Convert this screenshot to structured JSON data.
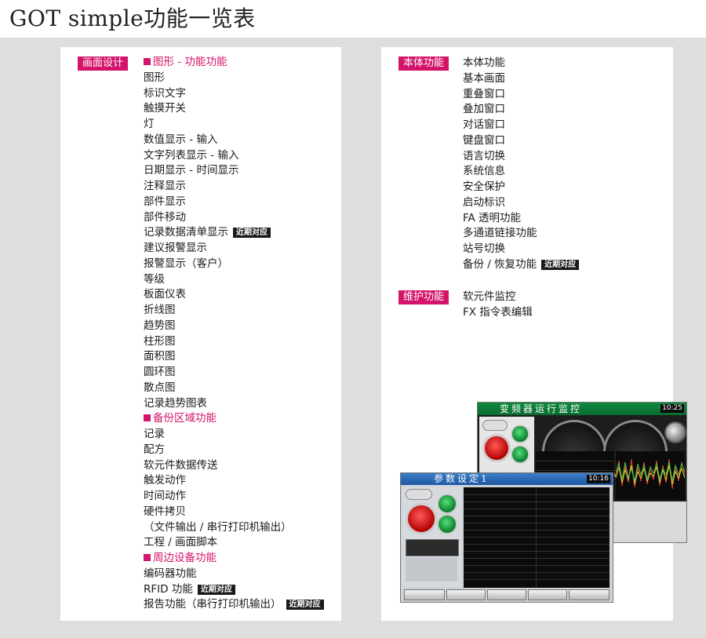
{
  "page": {
    "title": "GOT simple功能一览表"
  },
  "badge_label": "近期对应",
  "left": {
    "tag": "画面设计",
    "items": [
      {
        "text": "图形 - 功能功能",
        "section": true,
        "badge": false
      },
      {
        "text": "图形",
        "section": false,
        "badge": false
      },
      {
        "text": "标识文字",
        "section": false,
        "badge": false
      },
      {
        "text": "触摸开关",
        "section": false,
        "badge": false
      },
      {
        "text": "灯",
        "section": false,
        "badge": false
      },
      {
        "text": "数值显示 - 输入",
        "section": false,
        "badge": false
      },
      {
        "text": "文字列表显示 - 输入",
        "section": false,
        "badge": false
      },
      {
        "text": "日期显示 - 时间显示",
        "section": false,
        "badge": false
      },
      {
        "text": "注释显示",
        "section": false,
        "badge": false
      },
      {
        "text": "部件显示",
        "section": false,
        "badge": false
      },
      {
        "text": "部件移动",
        "section": false,
        "badge": false
      },
      {
        "text": "记录数据清单显示",
        "section": false,
        "badge": true
      },
      {
        "text": "建议报警显示",
        "section": false,
        "badge": false
      },
      {
        "text": "报警显示（客户）",
        "section": false,
        "badge": false
      },
      {
        "text": "等级",
        "section": false,
        "badge": false
      },
      {
        "text": "板面仪表",
        "section": false,
        "badge": false
      },
      {
        "text": "折线图",
        "section": false,
        "badge": false
      },
      {
        "text": "趋势图",
        "section": false,
        "badge": false
      },
      {
        "text": "柱形图",
        "section": false,
        "badge": false
      },
      {
        "text": "面积图",
        "section": false,
        "badge": false
      },
      {
        "text": "圆环图",
        "section": false,
        "badge": false
      },
      {
        "text": "散点图",
        "section": false,
        "badge": false
      },
      {
        "text": "记录趋势图表",
        "section": false,
        "badge": false
      },
      {
        "text": "备份区域功能",
        "section": true,
        "badge": false
      },
      {
        "text": "记录",
        "section": false,
        "badge": false
      },
      {
        "text": "配方",
        "section": false,
        "badge": false
      },
      {
        "text": "软元件数据传送",
        "section": false,
        "badge": false
      },
      {
        "text": "触发动作",
        "section": false,
        "badge": false
      },
      {
        "text": "时间动作",
        "section": false,
        "badge": false
      },
      {
        "text": "硬件拷贝",
        "section": false,
        "badge": false
      },
      {
        "text": "（文件输出 / 串行打印机输出）",
        "section": false,
        "badge": false
      },
      {
        "text": "工程 / 画面脚本",
        "section": false,
        "badge": false
      },
      {
        "text": "周边设备功能",
        "section": true,
        "badge": false
      },
      {
        "text": "编码器功能",
        "section": false,
        "badge": false
      },
      {
        "text": "RFID 功能",
        "section": false,
        "badge": true
      },
      {
        "text": "报告功能（串行打印机输出）",
        "section": false,
        "badge": true
      }
    ]
  },
  "right": {
    "body_tag": "本体功能",
    "body_items": [
      {
        "text": "本体功能",
        "badge": false
      },
      {
        "text": "基本画面",
        "badge": false
      },
      {
        "text": "重叠窗口",
        "badge": false
      },
      {
        "text": "叠加窗口",
        "badge": false
      },
      {
        "text": "对话窗口",
        "badge": false
      },
      {
        "text": "键盘窗口",
        "badge": false
      },
      {
        "text": "语言切换",
        "badge": false
      },
      {
        "text": "系统信息",
        "badge": false
      },
      {
        "text": "安全保护",
        "badge": false
      },
      {
        "text": "启动标识",
        "badge": false
      },
      {
        "text": "FA 透明功能",
        "badge": false
      },
      {
        "text": "多通道链接功能",
        "badge": false
      },
      {
        "text": "站号切换",
        "badge": false
      },
      {
        "text": "备份 / 恢复功能",
        "badge": true
      }
    ],
    "maint_tag": "维护功能",
    "maint_items": [
      {
        "text": "软元件监控",
        "badge": false
      },
      {
        "text": "FX 指令表编辑",
        "badge": false
      }
    ]
  },
  "screens": {
    "back_title": "变频器运行监控",
    "back_clock": "10:25",
    "front_title": "参数设定1",
    "front_clock": "10:16"
  }
}
